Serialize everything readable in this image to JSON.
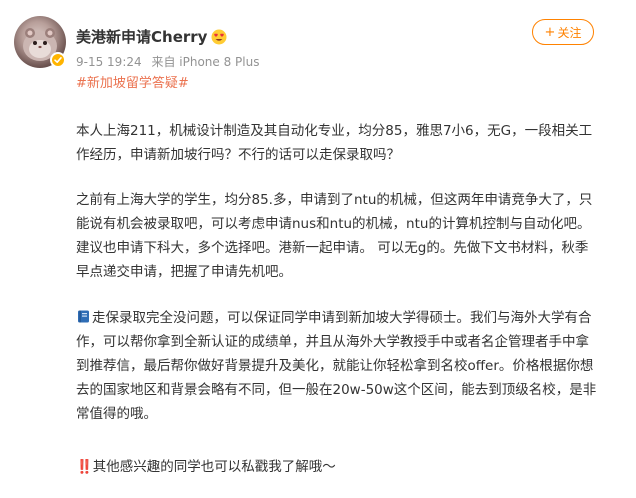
{
  "post": {
    "author": {
      "name": "美港新申请Cherry",
      "name_emoji": "smiling-face-with-heart-eyes-icon",
      "avatar_icon": "hamster-avatar-icon",
      "verified_icon": "verified-badge-icon"
    },
    "meta": {
      "time": "9-15 19:24",
      "source": "来自 iPhone 8 Plus"
    },
    "follow_button": {
      "label": "关注",
      "plus": "+"
    },
    "hashtag": "#新加坡留学答疑#",
    "paragraphs": {
      "p1": [
        "本人上海211，机械设计制造及其自动化专业，均分85，雅思7小6，无G，一段相关工",
        "作经历，申请新加坡行吗？不行的话可以走保录取吗？"
      ],
      "p2": [
        "之前有上海大学的学生，均分85.多，申请到了ntu的机械，但这两年申请竞争大了，只",
        "能说有机会被录取吧，可以考虑申请nus和ntu的机械，ntu的计算机控制与自动化吧。",
        "建议也申请下科大，多个选择吧。港新一起申请。 可以无g的。先做下文书材料，秋季",
        "早点递交申请，把握了申请先机吧。"
      ],
      "p3": [
        "走保录取完全没问题，可以保证同学申请到新加坡大学得硕士。我们与海外大学有合",
        "作，可以帮你拿到全新认证的成绩单，并且从海外大学教授手中或者名企管理者手中拿",
        "到推荐信，最后帮你做好背景提升及美化，就能让你轻松拿到名校offer。价格根据你想",
        "去的国家地区和背景会略有不同，但一般在20w-50w这个区间，能去到顶级名校，是非",
        "常值得的哦。"
      ],
      "p3_icon": "blue-book-icon",
      "p4": [
        "‼️其他感兴趣的同学也可以私戳我了解哦～"
      ]
    },
    "colors": {
      "accent": "#ff8200",
      "hashtag": "#eb7350",
      "text": "#333333",
      "meta": "#939393",
      "verified": "#ffb400"
    }
  }
}
